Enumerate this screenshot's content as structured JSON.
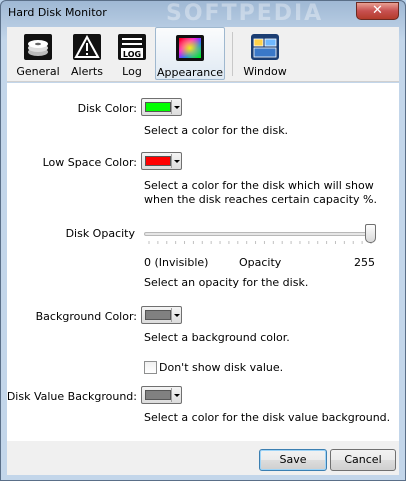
{
  "window": {
    "title": "Hard Disk Monitor",
    "watermark": "SOFTPEDIA",
    "close_glyph": "✕"
  },
  "toolbar": {
    "tabs": [
      {
        "label": "General",
        "icon": "disk-icon"
      },
      {
        "label": "Alerts",
        "icon": "warning-icon"
      },
      {
        "label": "Log",
        "icon": "log-icon",
        "icon_text": "LOG"
      },
      {
        "label": "Appearance",
        "icon": "palette-icon",
        "active": true
      },
      {
        "label": "Window",
        "icon": "window-icon"
      }
    ]
  },
  "appearance": {
    "disk_color": {
      "label": "Disk Color:",
      "color": "#00ff00",
      "desc": "Select a color for the disk."
    },
    "low_space_color": {
      "label": "Low Space Color:",
      "color": "#ff0000",
      "desc_line1": "Select a color for the disk which will show",
      "desc_line2": "when the disk reaches certain capacity %."
    },
    "disk_opacity": {
      "label": "Disk Opacity",
      "value": 255,
      "min": 0,
      "max": 255,
      "min_label": "0 (Invisible)",
      "mid_label": "Opacity",
      "max_label": "255",
      "desc": "Select an opacity for the disk."
    },
    "background_color": {
      "label": "Background Color:",
      "color": "#808080",
      "desc": "Select a background color."
    },
    "dont_show_value": {
      "label": "Don't show disk value.",
      "checked": false
    },
    "disk_value_background": {
      "label": "Disk Value Background:",
      "color": "#808080",
      "desc": "Select a color for the disk value background."
    }
  },
  "buttons": {
    "save": "Save",
    "cancel": "Cancel"
  }
}
